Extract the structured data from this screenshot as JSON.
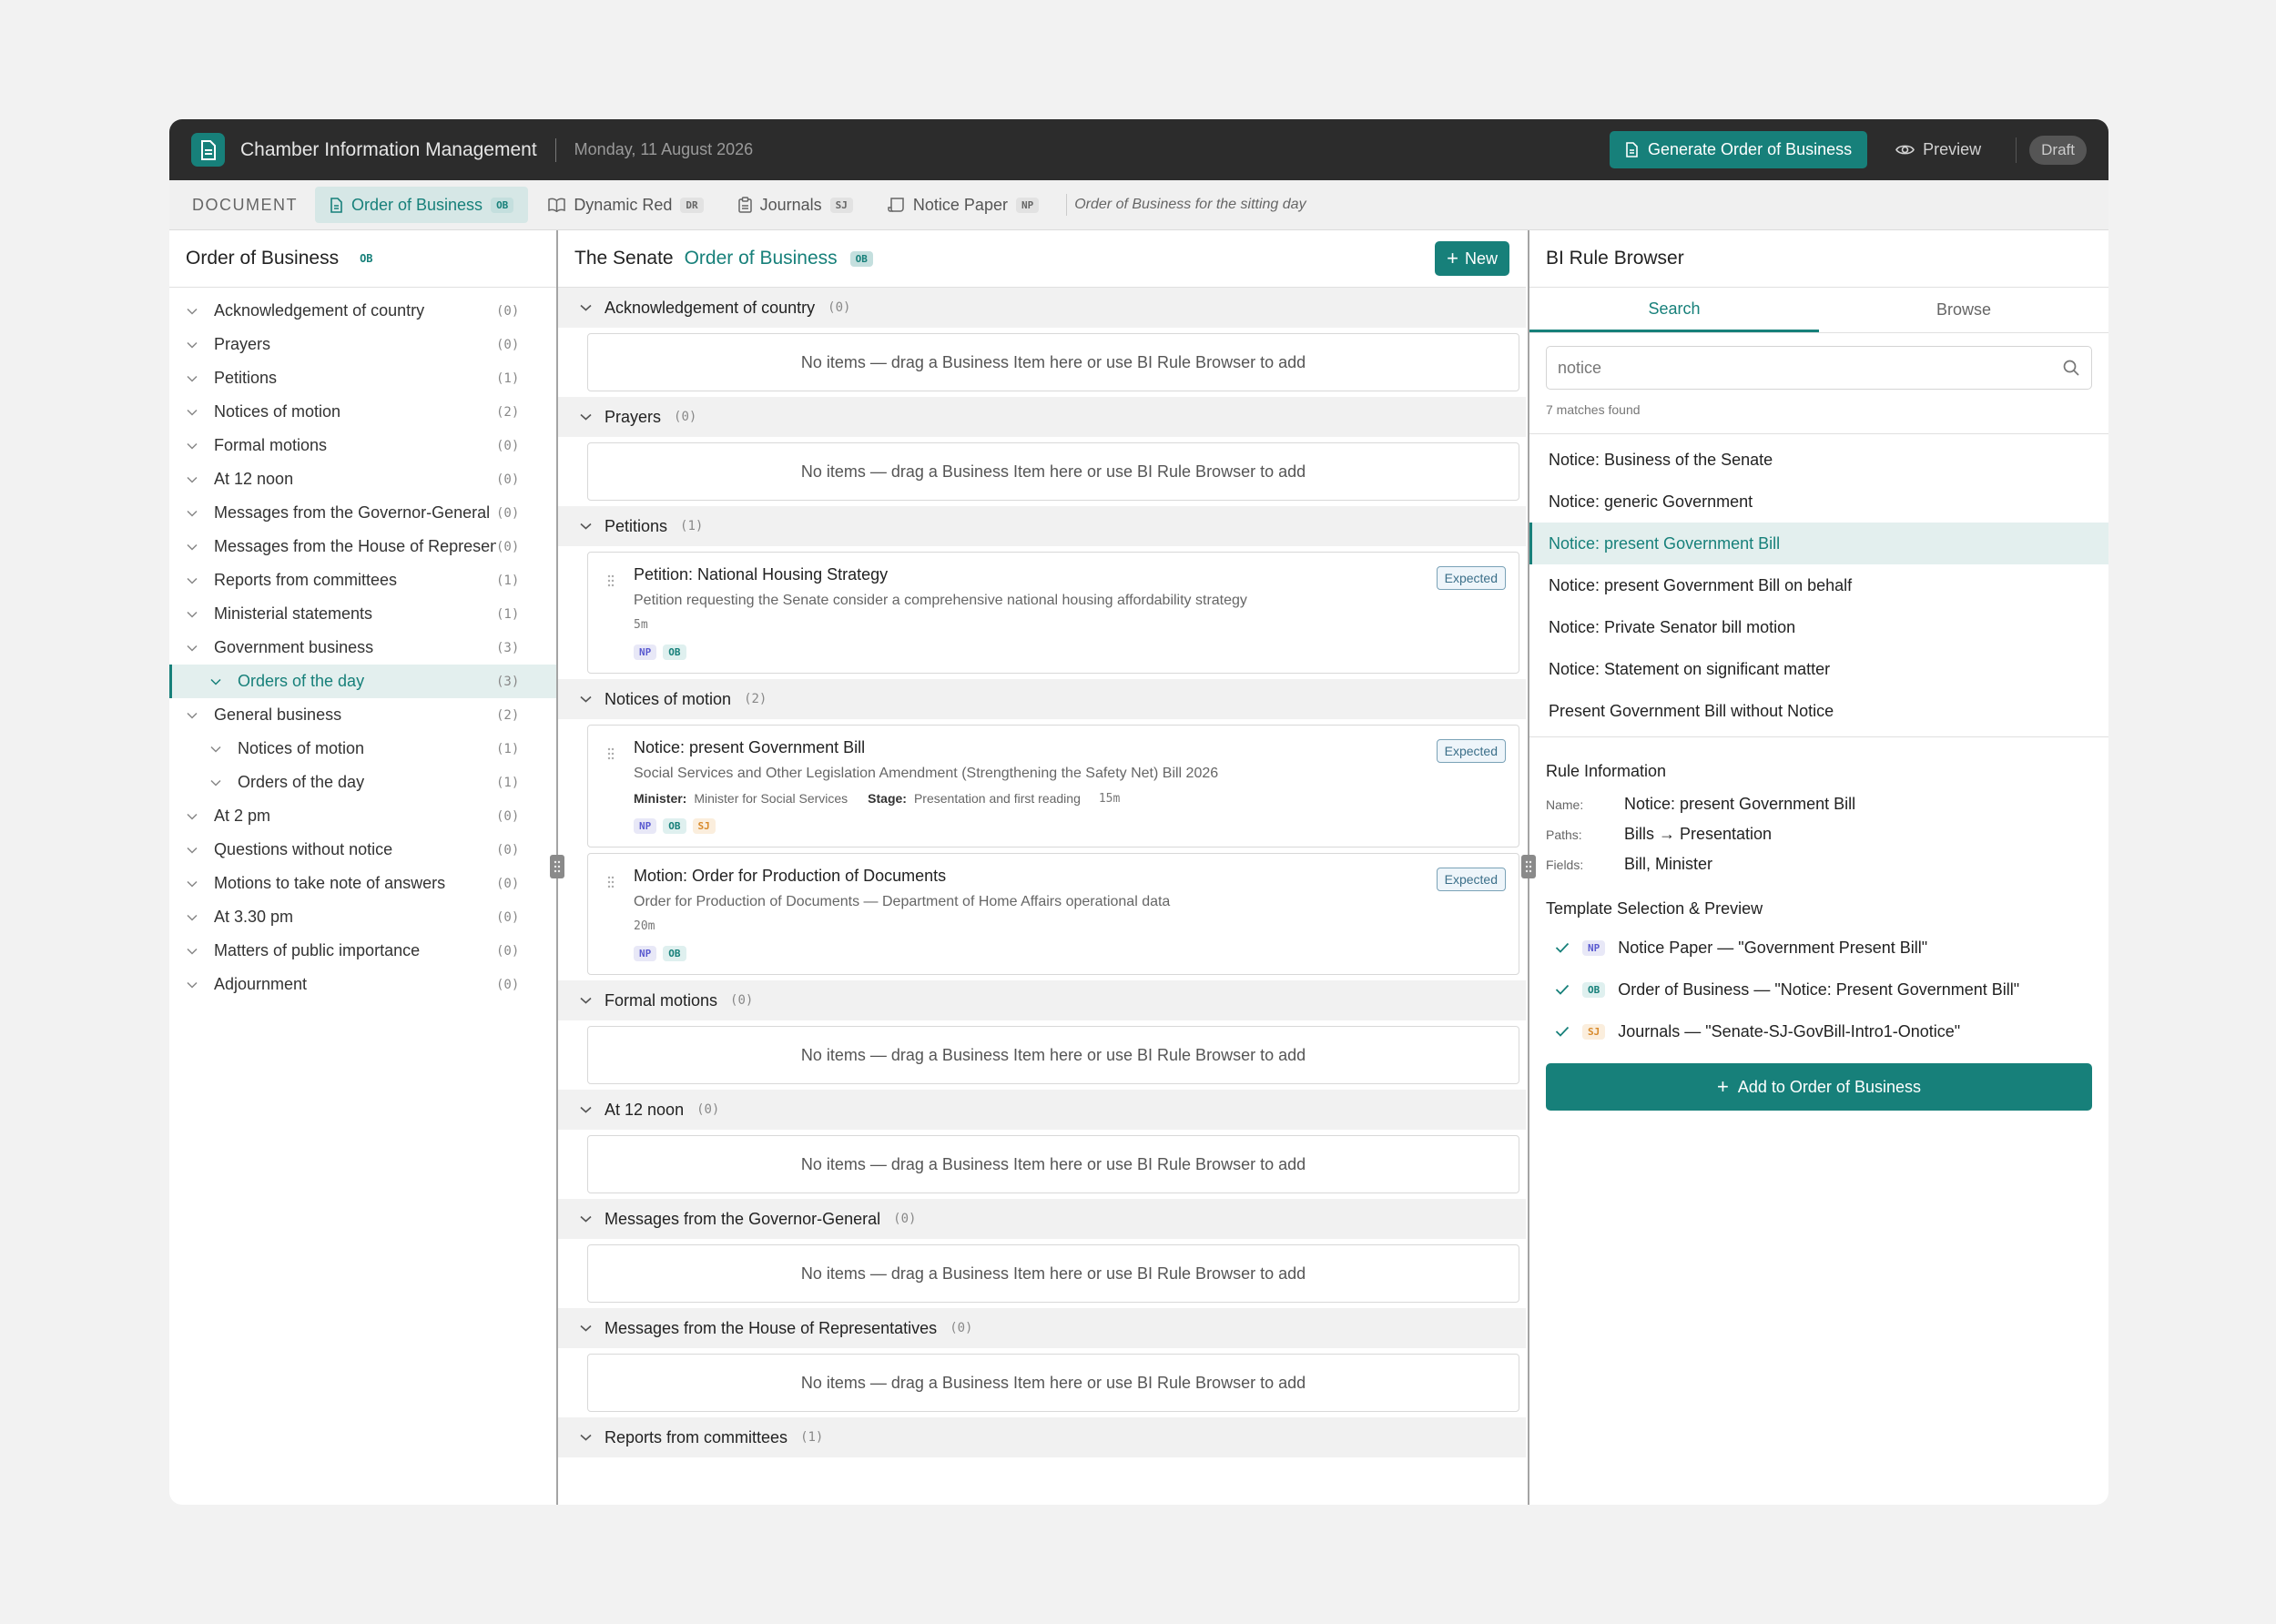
{
  "app": {
    "title": "Chamber Information Management",
    "date": "Monday, 11 August 2026",
    "generate_label": "Generate Order of Business",
    "preview_label": "Preview",
    "status": "Draft"
  },
  "tabs": {
    "label": "DOCUMENT",
    "items": [
      {
        "label": "Order of Business",
        "code": "OB"
      },
      {
        "label": "Dynamic Red",
        "code": "DR"
      },
      {
        "label": "Journals",
        "code": "SJ"
      },
      {
        "label": "Notice Paper",
        "code": "NP"
      }
    ],
    "description": "Order of Business for the sitting day"
  },
  "left": {
    "title": "Order of Business",
    "code": "OB",
    "items": [
      {
        "label": "Acknowledgement of country",
        "count": "(0)"
      },
      {
        "label": "Prayers",
        "count": "(0)"
      },
      {
        "label": "Petitions",
        "count": "(1)"
      },
      {
        "label": "Notices of motion",
        "count": "(2)"
      },
      {
        "label": "Formal motions",
        "count": "(0)"
      },
      {
        "label": "At 12 noon",
        "count": "(0)"
      },
      {
        "label": "Messages from the Governor-General",
        "count": "(0)"
      },
      {
        "label": "Messages from the House of Representatives",
        "count": "(0)"
      },
      {
        "label": "Reports from committees",
        "count": "(1)"
      },
      {
        "label": "Ministerial statements",
        "count": "(1)"
      },
      {
        "label": "Government business",
        "count": "(3)"
      },
      {
        "label": "Orders of the day",
        "count": "(3)"
      },
      {
        "label": "General business",
        "count": "(2)"
      },
      {
        "label": "Notices of motion",
        "count": "(1)"
      },
      {
        "label": "Orders of the day",
        "count": "(1)"
      },
      {
        "label": "At 2 pm",
        "count": "(0)"
      },
      {
        "label": "Questions without notice",
        "count": "(0)"
      },
      {
        "label": "Motions to take note of answers",
        "count": "(0)"
      },
      {
        "label": "At 3.30 pm",
        "count": "(0)"
      },
      {
        "label": "Matters of public importance",
        "count": "(0)"
      },
      {
        "label": "Adjournment",
        "count": "(0)"
      }
    ]
  },
  "center": {
    "title_prefix": "The Senate",
    "title": "Order of Business",
    "code": "OB",
    "new_label": "New",
    "empty_text": "No items — drag a Business Item here or use BI Rule Browser to add",
    "sections": [
      {
        "label": "Acknowledgement of country",
        "count": "(0)"
      },
      {
        "label": "Prayers",
        "count": "(0)"
      },
      {
        "label": "Petitions",
        "count": "(1)"
      },
      {
        "label": "Notices of motion",
        "count": "(2)"
      },
      {
        "label": "Formal motions",
        "count": "(0)"
      },
      {
        "label": "At 12 noon",
        "count": "(0)"
      },
      {
        "label": "Messages from the Governor-General",
        "count": "(0)"
      },
      {
        "label": "Messages from the House of Representatives",
        "count": "(0)"
      },
      {
        "label": "Reports from committees",
        "count": "(1)"
      }
    ],
    "cards": [
      {
        "title": "Petition: National Housing Strategy",
        "desc": "Petition requesting the Senate consider a comprehensive national housing affordability strategy",
        "duration": "5m",
        "status": "Expected",
        "codes": [
          "NP",
          "OB"
        ]
      },
      {
        "title": "Notice: present Government Bill",
        "desc": "Social Services and Other Legislation Amendment (Strengthening the Safety Net) Bill 2026",
        "minister_key": "Minister:",
        "minister": "Minister for Social Services",
        "stage_key": "Stage:",
        "stage": "Presentation and first reading",
        "duration": "15m",
        "status": "Expected",
        "codes": [
          "NP",
          "OB",
          "SJ"
        ]
      },
      {
        "title": "Motion: Order for Production of Documents",
        "desc": "Order for Production of Documents — Department of Home Affairs operational data",
        "duration": "20m",
        "status": "Expected",
        "codes": [
          "NP",
          "OB"
        ]
      }
    ]
  },
  "right": {
    "title": "BI Rule Browser",
    "tabs": [
      "Search",
      "Browse"
    ],
    "search_value": "notice",
    "matches": "7 matches found",
    "results": [
      "Notice: Business of the Senate",
      "Notice: generic Government",
      "Notice: present Government Bill",
      "Notice: present Government Bill on behalf",
      "Notice: Private Senator bill motion",
      "Notice: Statement on significant matter",
      "Present Government Bill without Notice"
    ],
    "info_title": "Rule Information",
    "name_key": "Name:",
    "name": "Notice: present Government Bill",
    "paths_key": "Paths:",
    "paths": "Bills → Presentation",
    "fields_key": "Fields:",
    "fields": "Bill, Minister",
    "template_title": "Template Selection & Preview",
    "templates": [
      {
        "code": "NP",
        "label": "Notice Paper — \"Government Present Bill\""
      },
      {
        "code": "OB",
        "label": "Order of Business — \"Notice: Present Government Bill\""
      },
      {
        "code": "SJ",
        "label": "Journals — \"Senate-SJ-GovBill-Intro1-Onotice\""
      }
    ],
    "add_label": "Add to Order of Business"
  },
  "colors": {
    "accent": "#17807a",
    "topbar": "#2c2c2c"
  }
}
